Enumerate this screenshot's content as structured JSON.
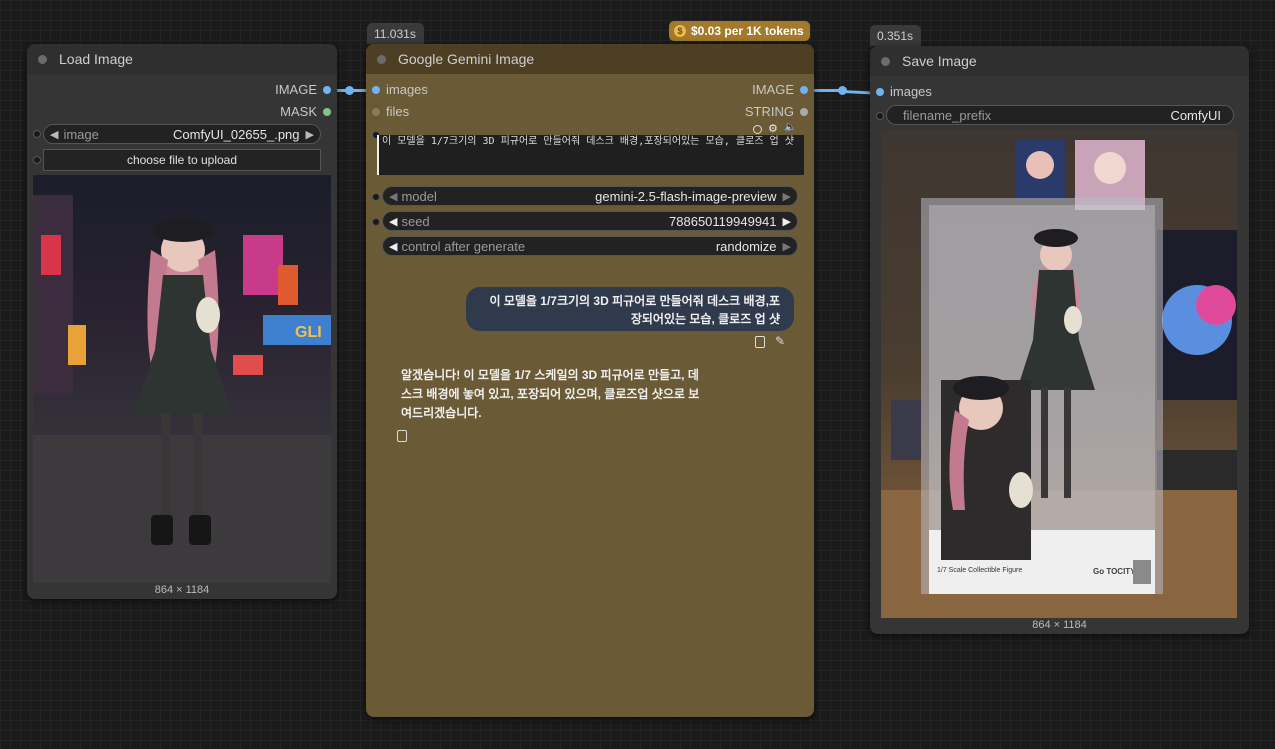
{
  "load_image": {
    "title": "Load Image",
    "outputs": [
      "IMAGE",
      "MASK"
    ],
    "image_label": "image",
    "image_value": "ComfyUI_02655_.png",
    "upload_label": "choose file to upload",
    "dimensions": "864 × 1184"
  },
  "gemini": {
    "timing": "11.031s",
    "price": "$0.03 per 1K tokens",
    "title": "Google Gemini Image",
    "inputs": [
      "images",
      "files"
    ],
    "outputs": [
      "IMAGE",
      "STRING"
    ],
    "prompt_text": "이 모델을 1/7크기의 3D 피규어로 만들어줘 데스크 배경,포장되어있는 모습, 클로즈 업 샷",
    "model_label": "model",
    "model_value": "gemini-2.5-flash-image-preview",
    "seed_label": "seed",
    "seed_value": "788650119949941",
    "control_label": "control after generate",
    "control_value": "randomize",
    "user_message": "이 모델을 1/7크기의 3D 피규어로 만들어줘 데스크 배경,포장되어있는 모습, 클로즈 업 샷",
    "assistant_message": "알겠습니다! 이 모델을 1/7 스케일의 3D 피규어로 만들고, 데스크 배경에 놓여 있고, 포장되어 있으며, 클로즈업 샷으로 보여드리겠습니다."
  },
  "save_image": {
    "timing": "0.351s",
    "title": "Save Image",
    "input": "images",
    "prefix_label": "filename_prefix",
    "prefix_value": "ComfyUI",
    "dimensions": "864 × 1184",
    "box_text": "1/7 Scale Collectible Figure",
    "box_brand": "Go TOCITY"
  },
  "colors": {
    "image_slot": "#6fb3f0",
    "mask_slot": "#81c784",
    "string_slot": "#aaaaaa",
    "gemini_body": "#6b5a36",
    "gemini_title": "#4d3f23",
    "price_badge": "#a37a2c"
  }
}
